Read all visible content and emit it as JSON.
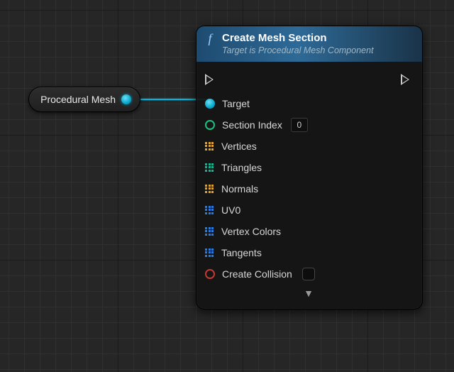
{
  "colors": {
    "object_pin": "#09b4d6",
    "int_pin": "#19c083",
    "bool_pin": "#c23a2f",
    "struct_gold": "#d9a43a",
    "struct_teal": "#1fae8f",
    "struct_blue": "#2f7bd4"
  },
  "var_node": {
    "label": "Procedural Mesh"
  },
  "func_node": {
    "icon_glyph": "f",
    "title": "Create Mesh Section",
    "subtitle": "Target is Procedural Mesh Component",
    "expand_glyph": "▼",
    "pins": {
      "target": {
        "label": "Target"
      },
      "section_index": {
        "label": "Section Index",
        "value": "0"
      },
      "vertices": {
        "label": "Vertices"
      },
      "triangles": {
        "label": "Triangles"
      },
      "normals": {
        "label": "Normals"
      },
      "uv0": {
        "label": "UV0"
      },
      "vertex_colors": {
        "label": "Vertex Colors"
      },
      "tangents": {
        "label": "Tangents"
      },
      "create_collision": {
        "label": "Create Collision",
        "checked": false
      }
    }
  }
}
